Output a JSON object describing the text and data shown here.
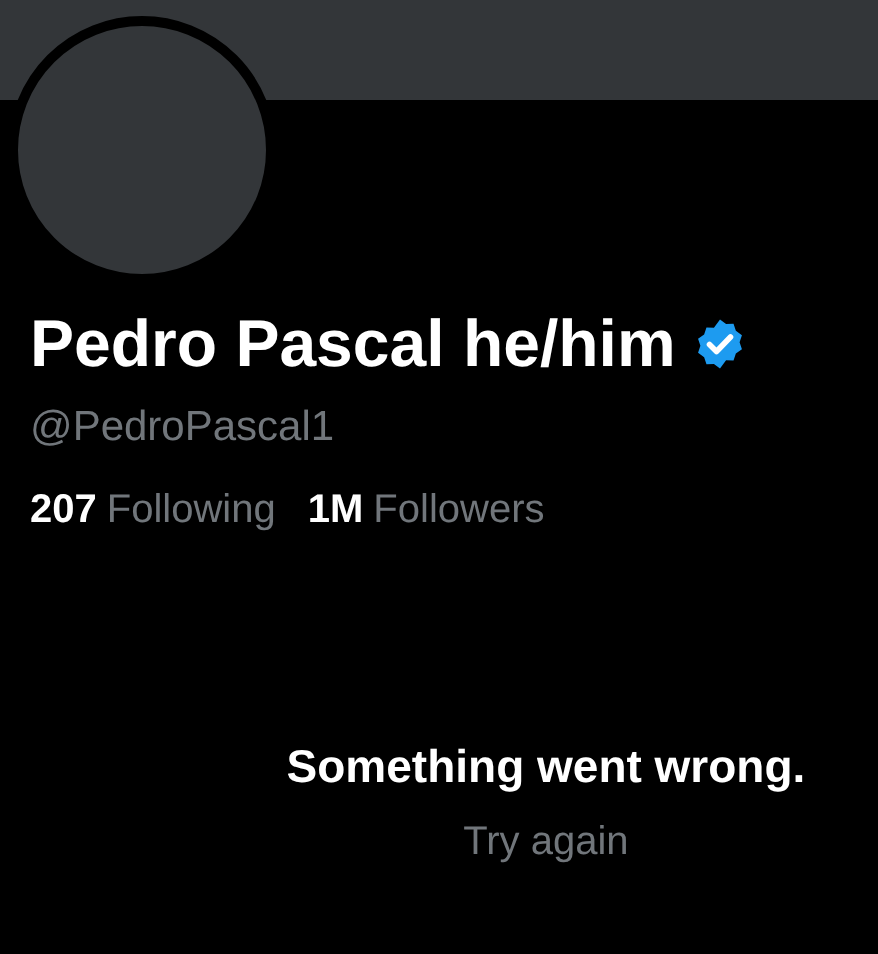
{
  "profile": {
    "display_name": "Pedro Pascal he/him",
    "verified": true,
    "handle": "@PedroPascal1",
    "stats": [
      {
        "count": "207",
        "label": "Following"
      },
      {
        "count": "1M",
        "label": "Followers"
      }
    ]
  },
  "error": {
    "message": "Something went wrong.",
    "retry": "Try again"
  }
}
